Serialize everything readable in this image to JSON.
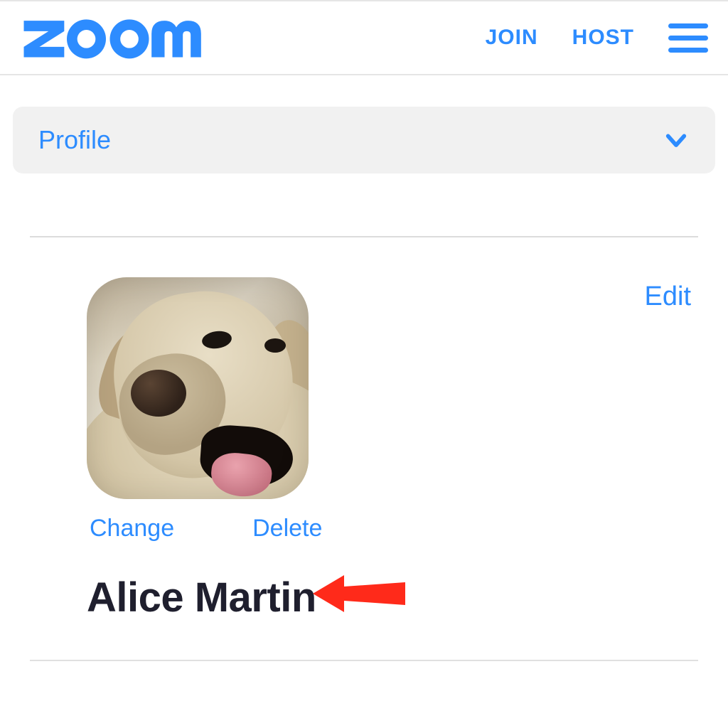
{
  "brand": {
    "name": "zoom",
    "color": "#2D8CFF"
  },
  "header": {
    "nav": {
      "join": "JOIN",
      "host": "HOST"
    }
  },
  "section_dropdown": {
    "label": "Profile"
  },
  "profile": {
    "edit_label": "Edit",
    "avatar_actions": {
      "change": "Change",
      "delete": "Delete"
    },
    "display_name": "Alice Martin",
    "avatar_description": "dog-photo"
  },
  "annotation": {
    "points_to": "delete-avatar-link",
    "color": "#ff2a1a"
  }
}
